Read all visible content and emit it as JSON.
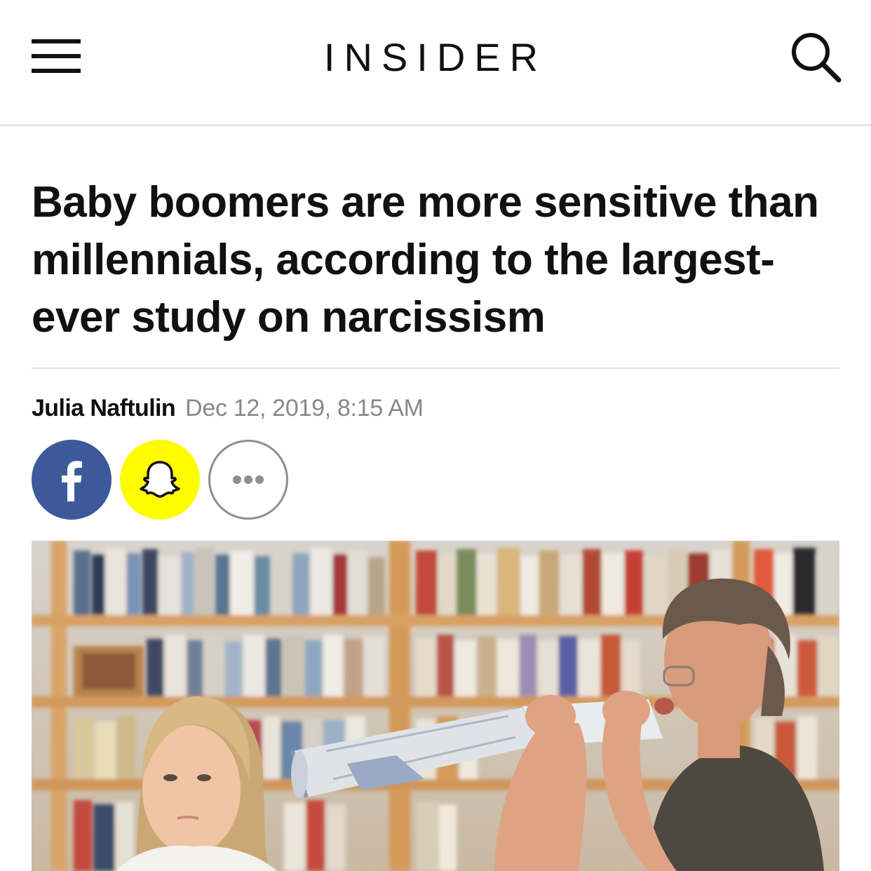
{
  "header": {
    "logo": "INSIDER",
    "menu_icon": "hamburger-menu-icon",
    "search_icon": "search-icon"
  },
  "article": {
    "headline": "Baby boomers are more sensitive than millennials, according to the largest-ever study on narcissism",
    "author": "Julia Naftulin",
    "date": "Dec 12, 2019, 8:15 AM"
  },
  "share": [
    {
      "name": "facebook",
      "icon": "facebook-icon",
      "color": "#3c5a99"
    },
    {
      "name": "snapchat",
      "icon": "snapchat-ghost-icon",
      "color": "#fffc00"
    },
    {
      "name": "more",
      "icon": "ellipsis-icon",
      "color": "#8a8f94"
    }
  ],
  "colors": {
    "text": "#111111",
    "meta": "#888888",
    "divider": "#e3e3e3"
  }
}
